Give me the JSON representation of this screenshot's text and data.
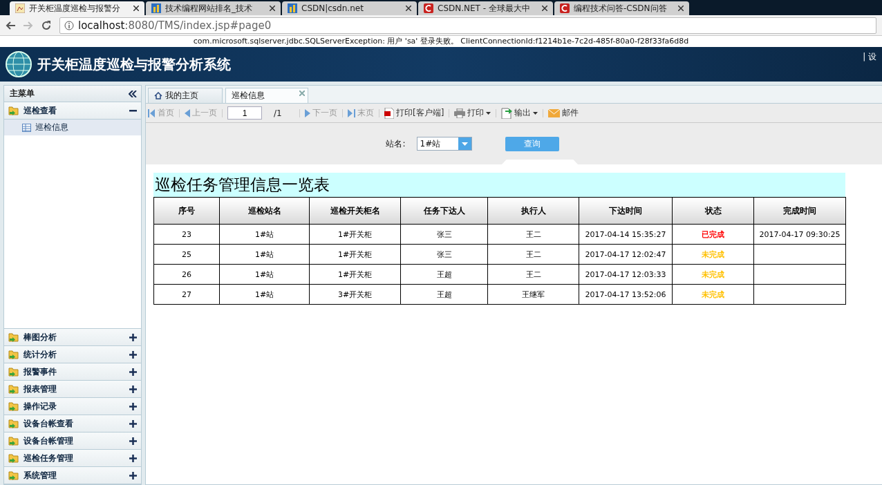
{
  "browser": {
    "tabs": [
      {
        "title": "开关柜温度巡检与报警分",
        "kind": "app",
        "selected": true
      },
      {
        "title": "技术编程网站排名_技术",
        "kind": "bars",
        "selected": false
      },
      {
        "title": "CSDN|csdn.net",
        "kind": "bars",
        "selected": false
      },
      {
        "title": "CSDN.NET - 全球最大中",
        "kind": "csdn",
        "selected": false
      },
      {
        "title": "编程技术问答-CSDN问答",
        "kind": "csdn",
        "selected": false
      }
    ],
    "address": {
      "host": "localhost",
      "rest": ":8080/TMS/index.jsp#page0"
    }
  },
  "error_message": "com.microsoft.sqlserver.jdbc.SQLServerException: 用户 'sa' 登录失败。 ClientConnectionId:f1214b1e-7c2d-485f-80a0-f28f33fa6d8d",
  "header": {
    "title": "开关柜温度巡检与报警分析系统",
    "right_text": "| 设"
  },
  "sidebar": {
    "title": "主菜单",
    "groups": [
      {
        "label": "巡检查看",
        "expanded": true,
        "children": [
          {
            "label": "巡检信息",
            "selected": true
          }
        ]
      },
      {
        "label": "棒图分析",
        "expanded": false
      },
      {
        "label": "统计分析",
        "expanded": false
      },
      {
        "label": "报警事件",
        "expanded": false
      },
      {
        "label": "报表管理",
        "expanded": false
      },
      {
        "label": "操作记录",
        "expanded": false
      },
      {
        "label": "设备台帐查看",
        "expanded": false
      },
      {
        "label": "设备台帐管理",
        "expanded": false
      },
      {
        "label": "巡检任务管理",
        "expanded": false
      },
      {
        "label": "系统管理",
        "expanded": false
      }
    ]
  },
  "tabs": [
    {
      "label": "我的主页",
      "selected": false,
      "closable": false
    },
    {
      "label": "巡检信息",
      "selected": true,
      "closable": true
    }
  ],
  "toolbar": {
    "items": [
      {
        "kind": "first",
        "label": "首页",
        "disabled": true
      },
      {
        "kind": "prev",
        "label": "上一页",
        "disabled": true
      },
      {
        "kind": "page",
        "value": "1",
        "total": "/1"
      },
      {
        "kind": "next",
        "label": "下一页",
        "disabled": true
      },
      {
        "kind": "last",
        "label": "末页",
        "disabled": true
      },
      {
        "kind": "pdf",
        "label": "打印[客户端]",
        "disabled": false
      },
      {
        "kind": "printer",
        "label": "打印",
        "disabled": false,
        "dropdown": true
      },
      {
        "kind": "export",
        "label": "输出",
        "disabled": false,
        "dropdown": true
      },
      {
        "kind": "mail",
        "label": "邮件",
        "disabled": false
      }
    ]
  },
  "search": {
    "label": "站名:",
    "value": "1#站",
    "button": "查询"
  },
  "table": {
    "title": "巡检任务管理信息一览表",
    "columns": [
      "序号",
      "巡检站名",
      "巡检开关柜名",
      "任务下达人",
      "执行人",
      "下达时间",
      "状态",
      "完成时间"
    ],
    "rows": [
      {
        "cells": [
          "23",
          "1#站",
          "1#开关柜",
          "张三",
          "王二",
          "2017-04-14 15:35:27",
          "已完成",
          "2017-04-17 09:30:25"
        ],
        "color": "#ff0000"
      },
      {
        "cells": [
          "25",
          "1#站",
          "1#开关柜",
          "张三",
          "王二",
          "2017-04-17 12:02:47",
          "未完成"
        ],
        "color": "#ffc000"
      },
      {
        "cells": [
          "26",
          "1#站",
          "1#开关柜",
          "王超",
          "王二",
          "2017-04-17 12:03:33",
          "未完成"
        ],
        "color": "#ffc000"
      },
      {
        "cells": [
          "27",
          "1#站",
          "3#开关柜",
          "王超",
          "王继军",
          "2017-04-17 13:52:06",
          "未完成"
        ],
        "color": "#ffc000"
      }
    ]
  }
}
